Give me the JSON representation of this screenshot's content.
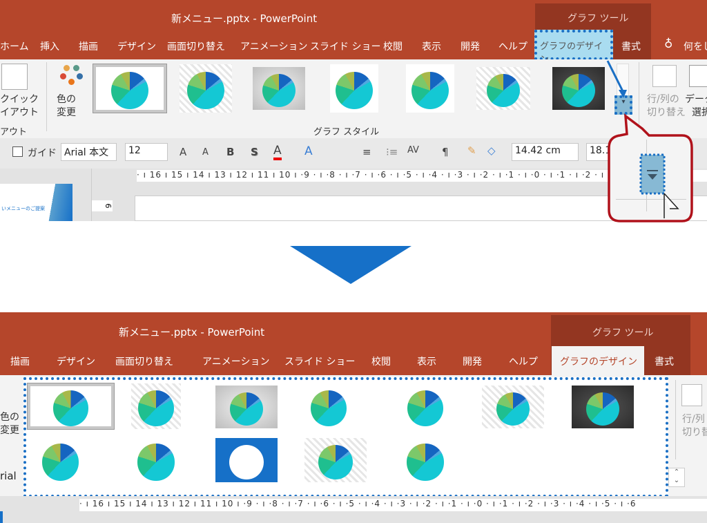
{
  "top": {
    "title": "新メニュー.pptx  -  PowerPoint",
    "context_group": "グラフ ツール",
    "tabs": [
      "ホーム",
      "挿入",
      "描画",
      "デザイン",
      "画面切り替え",
      "アニメーション",
      "スライド ショー",
      "校閲",
      "表示",
      "開発",
      "ヘルプ",
      "グラフのデザイン",
      "書式"
    ],
    "tell_me": "何をし",
    "quick_layout": [
      "クイック",
      "イアウト"
    ],
    "layout_group": "アウト",
    "change_colors": [
      "色の",
      "変更"
    ],
    "chart_styles_label": "グラフ スタイル",
    "switch_row_col": [
      "行/列の",
      "切り替え"
    ],
    "select_data": [
      "データ",
      "選択"
    ],
    "guide_label": "ガイド",
    "font_name": "Arial 本文",
    "font_size": "12",
    "height_value": "14.42 cm",
    "width_value": "18.1",
    "ruler": "· ı 16 ı 15 ı 14 ı 13 ı 12 ı 11 ı 10 ı ·9 · ı ·8 · ı ·7 · ı ·6 · ı ·5 · ı ·4 · ı ·3 · ı ·2 · ı ·1 · ı ·0 · ı ·1 · ı ·2 · ı ·3 ·",
    "slide_thumb_text": "いメニューのご提案",
    "vruler": "6"
  },
  "bottom": {
    "title": "新メニュー.pptx  -  PowerPoint",
    "context_group": "グラフ ツール",
    "tabs": [
      "描画",
      "デザイン",
      "画面切り替え",
      "アニメーション",
      "スライド ショー",
      "校閲",
      "表示",
      "開発",
      "ヘルプ",
      "グラフのデザイン",
      "書式"
    ],
    "change_colors": [
      "色の",
      "変更"
    ],
    "switch_row_col": [
      "行/列",
      "切り替"
    ],
    "font_fragment": "rial",
    "ruler": "· ı 16 ı 15 ı 14 ı 13 ı 12 ı 11 ı 10 ı ·9 · ı ·8 · ı ·7 · ı ·6 · ı ·5 · ı ·4 · ı ·3 · ı ·2 · ı ·1 · ı ·0 · ı ·1 · ı ·2 · ı ·3 · ı ·4 · ı ·5 · ı ·6"
  },
  "chart_styles": [
    "white",
    "stripe",
    "grey",
    "white",
    "white",
    "stripe",
    "dark",
    "white",
    "white",
    "blue",
    "stripe",
    "white"
  ],
  "colors": {
    "title_bar": "#b5462b",
    "context": "#933621",
    "highlight": "#1a6fc4",
    "callout": "#b0121b"
  },
  "icons": [
    "quick-layout-icon",
    "palette-icon",
    "lightbulb-icon",
    "switch-row-column-icon",
    "select-data-icon",
    "scroll-more-icon",
    "down-arrow-icon"
  ]
}
